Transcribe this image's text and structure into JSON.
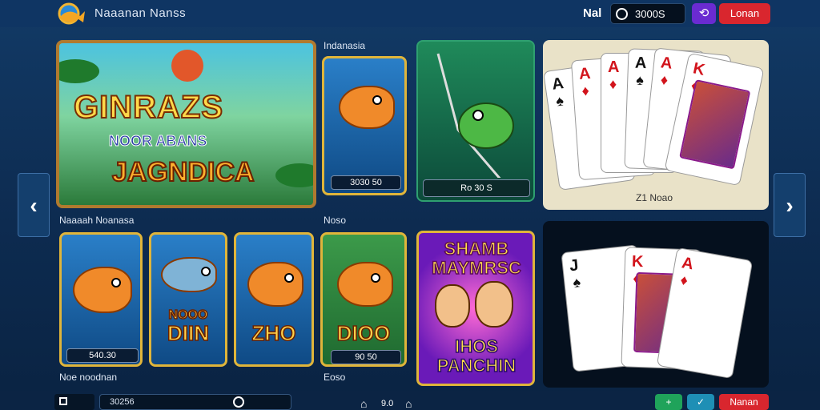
{
  "header": {
    "title": "Naaanan Nanss",
    "user": "Nal",
    "balance": "3000S",
    "logout_label": "Lonan"
  },
  "sections": {
    "top_label": "Indanasia",
    "mid_left_label": "Naaaah Noanasa",
    "mid_right_label": "Noso",
    "bottom_left_label": "Noe noodnan",
    "bottom_right_label": "Eoso"
  },
  "hero": {
    "title": "GINRAZS",
    "subtitle": "NOOR ABANS",
    "subtitle2": "JAGNDICA"
  },
  "tiles": {
    "fish_top": {
      "price": "3030 50"
    },
    "fishing": {
      "price": "Ro 30 S"
    },
    "cards_top": {
      "caption": "Z1 Noao"
    },
    "row": [
      {
        "name": "",
        "price": "540.30"
      },
      {
        "name": "DIIN",
        "label_top": "NOOO"
      },
      {
        "name": "ZHO",
        "label_top": ""
      },
      {
        "name": "DIOO",
        "price": "90 50"
      }
    ],
    "show": {
      "title1": "SHAMB",
      "title2": "MAYMRSC",
      "bottom1": "IHOS",
      "bottom2": "PANCHIN"
    }
  },
  "cards": {
    "top": [
      {
        "rank": "A",
        "suit": "♠"
      },
      {
        "rank": "A",
        "suit": "♦"
      },
      {
        "rank": "A",
        "suit": "♦"
      },
      {
        "rank": "A",
        "suit": "♠"
      },
      {
        "rank": "A",
        "suit": "♦"
      },
      {
        "rank": "K",
        "suit": "♦"
      }
    ],
    "bottom": [
      {
        "rank": "J",
        "suit": "♠"
      },
      {
        "rank": "K",
        "suit": "♦"
      },
      {
        "rank": "A",
        "suit": "♦"
      }
    ]
  },
  "footer": {
    "search_value": "30256",
    "page_info": "9.0",
    "play_label": "+",
    "share_label": "✓",
    "deposit_label": "Nanan"
  }
}
